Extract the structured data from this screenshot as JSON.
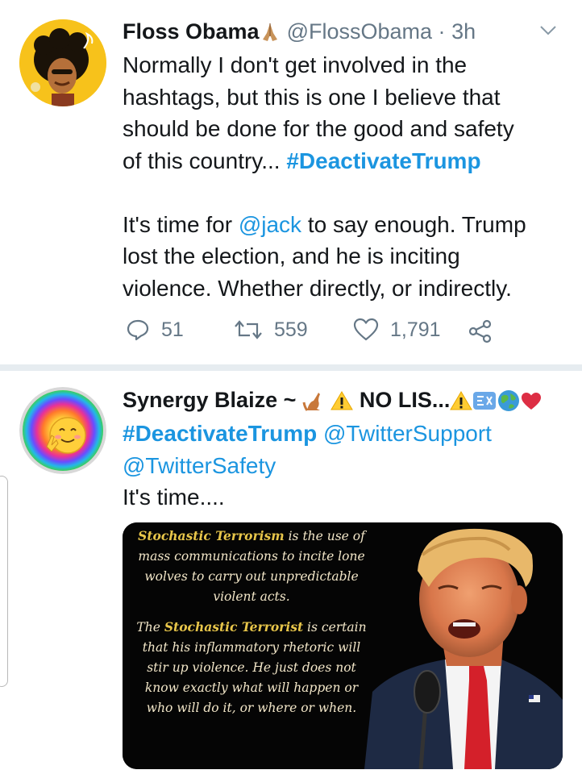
{
  "tweets": [
    {
      "display_name": "Floss Obama",
      "name_emoji": "folded-hands-emoji",
      "handle": "@FlossObama",
      "separator": "·",
      "time": "3h",
      "lines": [
        "Normally I don't get involved in the",
        "hashtags, but this is one I believe that",
        "should be done for the good and safety",
        "of this country... "
      ],
      "hashtag": "#DeactivateTrump",
      "mention": "@jack",
      "line2_pre": "It's time for ",
      "line2_post": " to say enough. Trump",
      "line3": "lost the election, and he is inciting",
      "line4": "violence. Whether directly, or indirectly.",
      "replies": "51",
      "retweets": "559",
      "likes": "1,791"
    },
    {
      "display_name": "Synergy Blaize ~",
      "name_suffix": "NO LIS...",
      "hashtag": "#DeactivateTrump",
      "mention1": "@TwitterSupport",
      "mention2": "@TwitterSafety",
      "text": "It's time....",
      "card": {
        "p1_bold": "Stochastic Terrorism",
        "p1_rest": " is the use of mass communications to incite lone wolves to carry out unpredictable violent acts.",
        "p2_pre": "The ",
        "p2_bold": "Stochastic Terrorist",
        "p2_rest": " is certain that his inflammatory rhetoric will stir up violence. He just does not know exactly what will happen or who will do it, or where or when."
      }
    }
  ],
  "colors": {
    "link": "#1b95e0",
    "secondary": "#657786",
    "divider": "#e6ecf0",
    "card_gold": "#e8c64a"
  }
}
